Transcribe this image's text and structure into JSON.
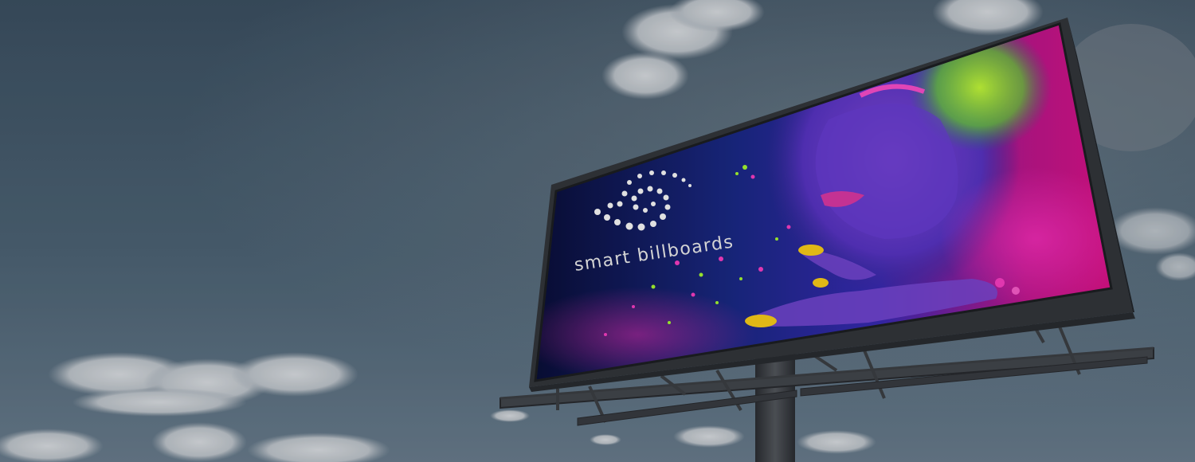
{
  "billboard": {
    "brand_text": "smart billboards",
    "logo_icon": "dotted-swirl-icon"
  },
  "colors": {
    "sky_top": "#3f5466",
    "sky_bottom": "#6d8193",
    "structure": "#3a3d42",
    "panel_magenta": "#ff1fb0",
    "panel_blue": "#1a2fb0",
    "neon_green": "#aaff33",
    "nail_yellow": "#ffd21a"
  }
}
